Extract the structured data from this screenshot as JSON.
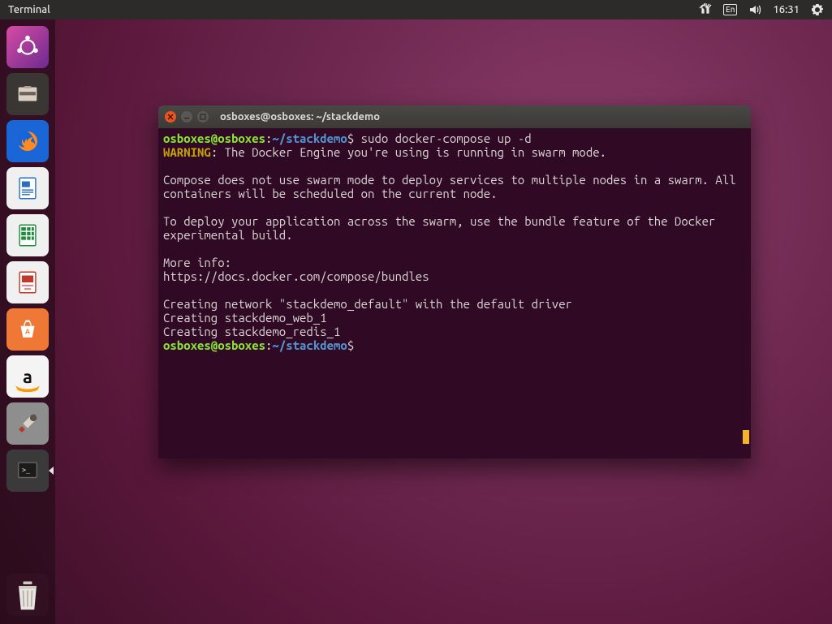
{
  "top_panel": {
    "active_app": "Terminal",
    "ime": "En",
    "clock": "16:31"
  },
  "launcher": {
    "items": [
      {
        "name": "dash",
        "tooltip": "Dash"
      },
      {
        "name": "files",
        "tooltip": "Files"
      },
      {
        "name": "firefox",
        "tooltip": "Firefox Web Browser"
      },
      {
        "name": "writer",
        "tooltip": "LibreOffice Writer"
      },
      {
        "name": "calc",
        "tooltip": "LibreOffice Calc"
      },
      {
        "name": "impress",
        "tooltip": "LibreOffice Impress"
      },
      {
        "name": "software",
        "tooltip": "Ubuntu Software"
      },
      {
        "name": "amazon",
        "tooltip": "Amazon",
        "letter": "a"
      },
      {
        "name": "settings",
        "tooltip": "System Settings"
      },
      {
        "name": "terminal",
        "tooltip": "Terminal"
      }
    ],
    "trash": "Trash"
  },
  "terminal": {
    "title": "osboxes@osboxes: ~/stackdemo",
    "prompt": {
      "userhost": "osboxes@osboxes",
      "path": "~/stackdemo",
      "symbol": "$"
    },
    "lines": {
      "cmd1": "sudo docker-compose up -d",
      "warn_label": "WARNING",
      "warn_text": ": The Docker Engine you're using is running in swarm mode.",
      "p1": "Compose does not use swarm mode to deploy services to multiple nodes in a swarm. All containers will be scheduled on the current node.",
      "p2": "To deploy your application across the swarm, use the bundle feature of the Docker experimental build.",
      "more": "More info:",
      "url": "https://docs.docker.com/compose/bundles",
      "c1": "Creating network \"stackdemo_default\" with the default driver",
      "c2": "Creating stackdemo_web_1",
      "c3": "Creating stackdemo_redis_1"
    }
  }
}
